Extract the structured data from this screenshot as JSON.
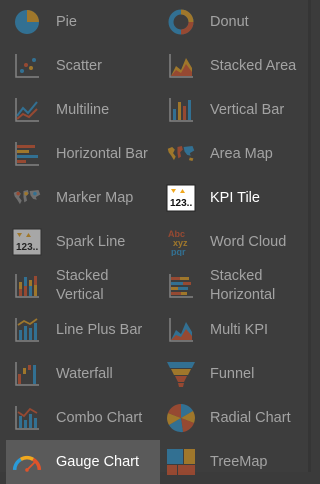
{
  "items": [
    {
      "label": "Pie",
      "icon": "pie-chart-icon"
    },
    {
      "label": "Donut",
      "icon": "donut-chart-icon"
    },
    {
      "label": "Scatter",
      "icon": "scatter-chart-icon"
    },
    {
      "label": "Stacked Area",
      "icon": "stacked-area-icon"
    },
    {
      "label": "Multiline",
      "icon": "multiline-chart-icon"
    },
    {
      "label": "Vertical Bar",
      "icon": "vertical-bar-icon"
    },
    {
      "label": "Horizontal Bar",
      "icon": "horizontal-bar-icon"
    },
    {
      "label": "Area Map",
      "icon": "area-map-icon"
    },
    {
      "label": "Marker Map",
      "icon": "marker-map-icon"
    },
    {
      "label": "KPI Tile",
      "icon": "kpi-tile-icon",
      "active": true
    },
    {
      "label": "Spark Line",
      "icon": "spark-line-icon"
    },
    {
      "label": "Word Cloud",
      "icon": "word-cloud-icon"
    },
    {
      "label": "Stacked\nVertical",
      "icon": "stacked-vertical-icon"
    },
    {
      "label": "Stacked\nHorizontal",
      "icon": "stacked-horizontal-icon"
    },
    {
      "label": "Line Plus Bar",
      "icon": "line-plus-bar-icon"
    },
    {
      "label": "Multi KPI",
      "icon": "multi-kpi-icon"
    },
    {
      "label": "Waterfall",
      "icon": "waterfall-icon"
    },
    {
      "label": "Funnel",
      "icon": "funnel-icon"
    },
    {
      "label": "Combo Chart",
      "icon": "combo-chart-icon"
    },
    {
      "label": "Radial Chart",
      "icon": "radial-chart-icon"
    },
    {
      "label": "Gauge Chart",
      "icon": "gauge-chart-icon",
      "hover": true
    },
    {
      "label": "TreeMap",
      "icon": "treemap-icon"
    }
  ],
  "kpi_icon_text": "123..",
  "word_cloud_icon_text": [
    "Abc",
    "xyz",
    "pqr"
  ]
}
